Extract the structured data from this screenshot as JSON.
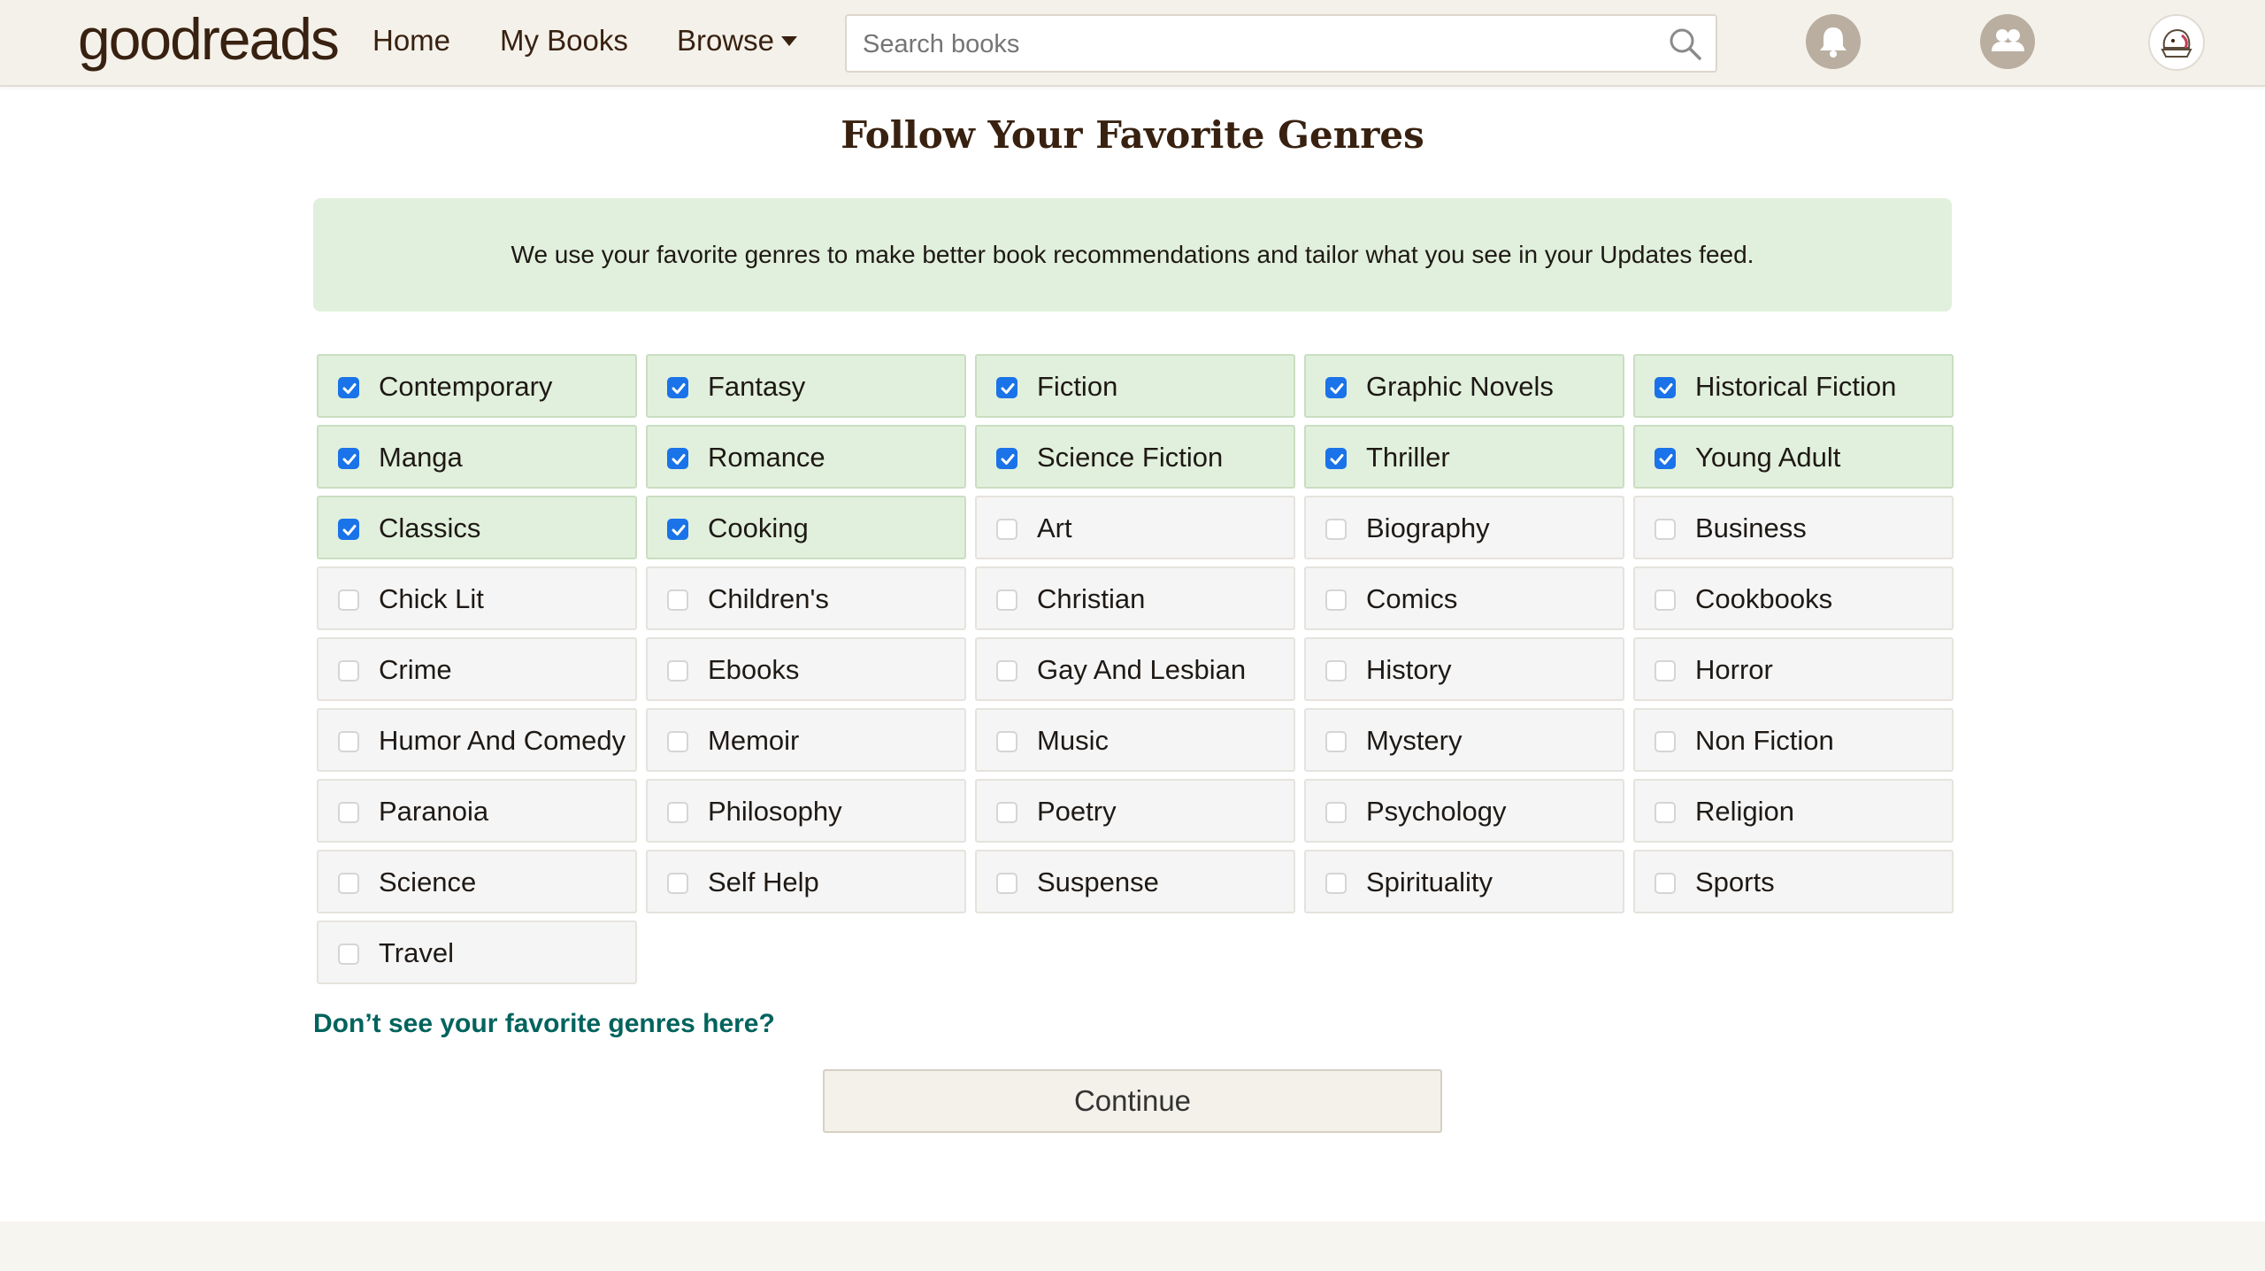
{
  "header": {
    "logo_text_light": "good",
    "logo_text_bold": "reads",
    "nav": {
      "home": "Home",
      "my_books": "My Books",
      "browse": "Browse"
    },
    "search": {
      "placeholder": "Search books",
      "value": ""
    }
  },
  "main": {
    "title": "Follow Your Favorite Genres",
    "info": "We use your favorite genres to make better book recommendations and tailor what you see in your Updates feed.",
    "genres": [
      {
        "label": "Contemporary",
        "checked": true
      },
      {
        "label": "Fantasy",
        "checked": true
      },
      {
        "label": "Fiction",
        "checked": true
      },
      {
        "label": "Graphic Novels",
        "checked": true
      },
      {
        "label": "Historical Fiction",
        "checked": true
      },
      {
        "label": "Manga",
        "checked": true
      },
      {
        "label": "Romance",
        "checked": true
      },
      {
        "label": "Science Fiction",
        "checked": true
      },
      {
        "label": "Thriller",
        "checked": true
      },
      {
        "label": "Young Adult",
        "checked": true
      },
      {
        "label": "Classics",
        "checked": true
      },
      {
        "label": "Cooking",
        "checked": true
      },
      {
        "label": "Art",
        "checked": false
      },
      {
        "label": "Biography",
        "checked": false
      },
      {
        "label": "Business",
        "checked": false
      },
      {
        "label": "Chick Lit",
        "checked": false
      },
      {
        "label": "Children's",
        "checked": false
      },
      {
        "label": "Christian",
        "checked": false
      },
      {
        "label": "Comics",
        "checked": false
      },
      {
        "label": "Cookbooks",
        "checked": false
      },
      {
        "label": "Crime",
        "checked": false
      },
      {
        "label": "Ebooks",
        "checked": false
      },
      {
        "label": "Gay And Lesbian",
        "checked": false
      },
      {
        "label": "History",
        "checked": false
      },
      {
        "label": "Horror",
        "checked": false
      },
      {
        "label": "Humor And Comedy",
        "checked": false
      },
      {
        "label": "Memoir",
        "checked": false
      },
      {
        "label": "Music",
        "checked": false
      },
      {
        "label": "Mystery",
        "checked": false
      },
      {
        "label": "Non Fiction",
        "checked": false
      },
      {
        "label": "Paranoia",
        "checked": false
      },
      {
        "label": "Philosophy",
        "checked": false
      },
      {
        "label": "Poetry",
        "checked": false
      },
      {
        "label": "Psychology",
        "checked": false
      },
      {
        "label": "Religion",
        "checked": false
      },
      {
        "label": "Science",
        "checked": false
      },
      {
        "label": "Self Help",
        "checked": false
      },
      {
        "label": "Suspense",
        "checked": false
      },
      {
        "label": "Spirituality",
        "checked": false
      },
      {
        "label": "Sports",
        "checked": false
      },
      {
        "label": "Travel",
        "checked": false
      }
    ],
    "more_link": "Don’t see your favorite genres here?",
    "continue": "Continue"
  },
  "colors": {
    "brand_brown": "#382110",
    "header_bg": "#f4f1ea",
    "checked_bg": "#e1f0dc",
    "checkbox_blue": "#1a73e8",
    "link_teal": "#00635d"
  },
  "icons": {
    "search": "search-icon",
    "notifications": "bell-icon",
    "friends": "friends-icon",
    "profile": "profile-avatar"
  }
}
